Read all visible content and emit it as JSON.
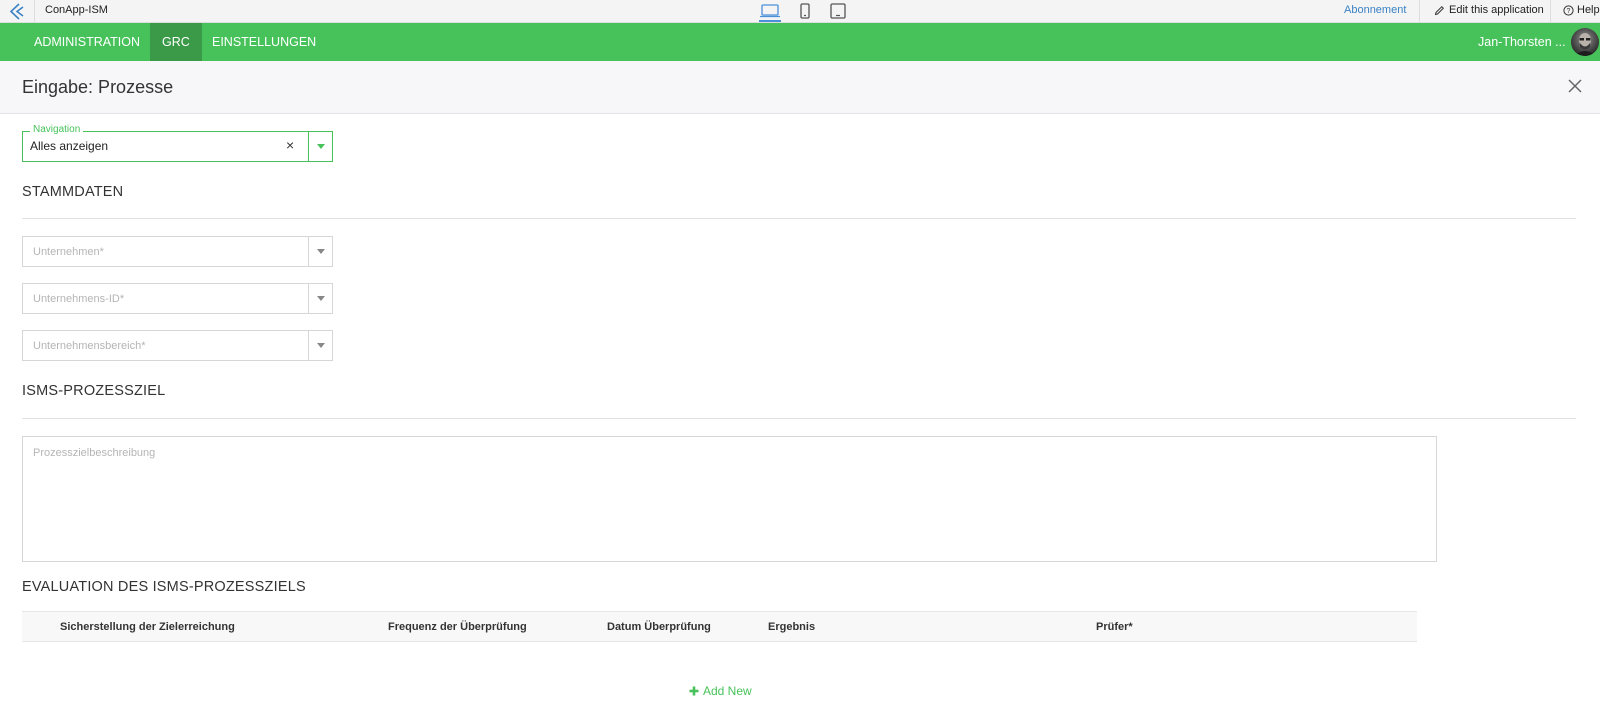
{
  "topbar": {
    "app_name": "ConApp-ISM",
    "subscription_link": "Abonnement",
    "edit_label": "Edit this application",
    "help_label": "Help"
  },
  "navbar": {
    "items": [
      {
        "label": "ADMINISTRATION",
        "active": false
      },
      {
        "label": "GRC",
        "active": true
      },
      {
        "label": "EINSTELLUNGEN",
        "active": false
      }
    ],
    "user_name": "Jan-Thorsten ..."
  },
  "header": {
    "title": "Eingabe: Prozesse"
  },
  "navigation_field": {
    "legend": "Navigation",
    "value": "Alles anzeigen",
    "clear_symbol": "×"
  },
  "sections": {
    "stammdaten": "STAMMDATEN",
    "prozessziel": "ISMS-PROZESSZIEL",
    "evaluation": "EVALUATION DES ISMS-PROZESSZIELS"
  },
  "fields": {
    "unternehmen_placeholder": "Unternehmen*",
    "unternehmens_id_placeholder": "Unternehmens-ID*",
    "unternehmensbereich_placeholder": "Unternehmensbereich*",
    "prozesszielbeschreibung_placeholder": "Prozesszielbeschreibung"
  },
  "table": {
    "columns": [
      "Sicherstellung der Zielerreichung",
      "Frequenz der Überprüfung",
      "Datum Überprüfung",
      "Ergebnis",
      "Prüfer*"
    ]
  },
  "add_new_label": "Add New",
  "colors": {
    "brand_green": "#47c25a",
    "active_nav": "#3a9a48",
    "link_blue": "#3b82c4"
  }
}
